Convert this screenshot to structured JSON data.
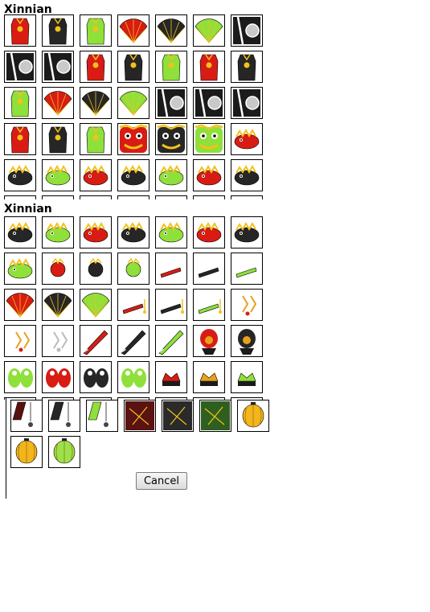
{
  "sections": [
    {
      "title": "Xinnian",
      "rows": [
        [
          "red-dress",
          "black-dress",
          "green-dress",
          "red-fan",
          "black-fan",
          "green-fan",
          "black-panel"
        ],
        [
          "black-panel",
          "black-panel",
          "red-dress",
          "black-dress",
          "green-dress",
          "red-dress",
          "black-dress"
        ],
        [
          "green-dress",
          "red-fan",
          "black-fan",
          "green-fan",
          "black-panel",
          "black-panel",
          "black-panel"
        ],
        [
          "red-robe",
          "black-robe",
          "green-robe",
          "red-lion-mask",
          "black-lion-mask",
          "green-lion-mask",
          "red-dragon"
        ],
        [
          "black-dragon",
          "green-dragon",
          "red-dragon-head",
          "black-dragon-head",
          "green-dragon-head",
          "red-dragon-face",
          "black-dragon-face"
        ],
        [
          "partial",
          "partial",
          "partial",
          "partial",
          "partial",
          "partial",
          "partial"
        ]
      ]
    },
    {
      "title": "Xinnian",
      "rows": [
        [
          "black-dragon",
          "green-dragon",
          "red-dragon-head",
          "black-dragon-head",
          "green-dragon-head",
          "red-dragon-face",
          "black-dragon-face"
        ],
        [
          "green-dragon-face",
          "red-small-head",
          "black-small-head",
          "green-small-head",
          "red-stick",
          "black-stick",
          "green-stick"
        ],
        [
          "red-fan",
          "black-fan",
          "green-fan",
          "red-stick-tassel",
          "black-stick-tassel",
          "green-stick-tassel",
          "orange-charm"
        ],
        [
          "orange-charm",
          "white-charm",
          "red-brush",
          "black-brush",
          "green-brush",
          "red-hood",
          "black-hood"
        ],
        [
          "green-lion-pair",
          "red-lion-pair",
          "black-lion-pair",
          "green-lion-pair",
          "red-crown",
          "orange-crown",
          "green-crown"
        ],
        [
          "partial",
          "partial",
          "partial",
          "partial",
          "partial",
          "partial",
          "partial"
        ]
      ]
    }
  ],
  "overflow_items": [
    "red-pendant",
    "black-pendant",
    "green-pendant",
    "red-cape",
    "black-cape",
    "green-cape",
    "orange-lantern",
    "orange-lantern",
    "green-lantern"
  ],
  "cancel_label": "Cancel",
  "colors": {
    "red": "#d81c14",
    "black": "#262626",
    "green": "#8fe03a",
    "orange": "#e8a21a",
    "gold": "#f2c21b",
    "white": "#ffffff"
  }
}
